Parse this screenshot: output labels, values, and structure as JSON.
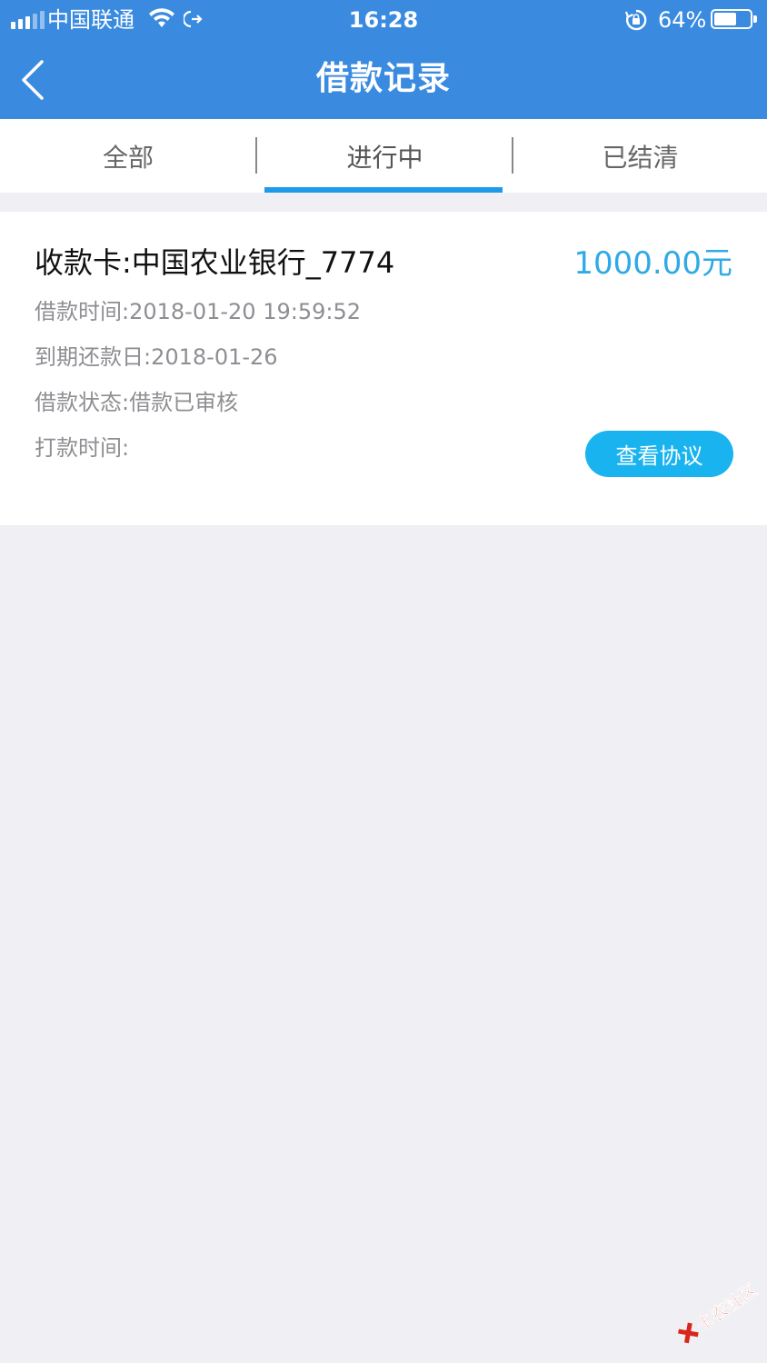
{
  "status_bar": {
    "carrier": "中国联通",
    "time": "16:28",
    "battery": "64%",
    "battery_level": 0.64
  },
  "nav": {
    "title": "借款记录"
  },
  "tabs": [
    {
      "label": "全部",
      "active": false
    },
    {
      "label": "进行中",
      "active": true
    },
    {
      "label": "已结清",
      "active": false
    }
  ],
  "record": {
    "title": "收款卡:中国农业银行_7774",
    "amount": "1000.00元",
    "loan_time": "借款时间:2018-01-20 19:59:52",
    "due_date": "到期还款日:2018-01-26",
    "loan_status": "借款状态:借款已审核",
    "payout_time": "打款时间:",
    "agreement_button": "查看协议"
  },
  "watermark": {
    "text": "卡农社区"
  },
  "colors": {
    "nav_bg": "#3a8be0",
    "accent": "#1e9be8",
    "amount": "#2eaae6",
    "button": "#19b4f0",
    "page_bg": "#efeff4"
  }
}
